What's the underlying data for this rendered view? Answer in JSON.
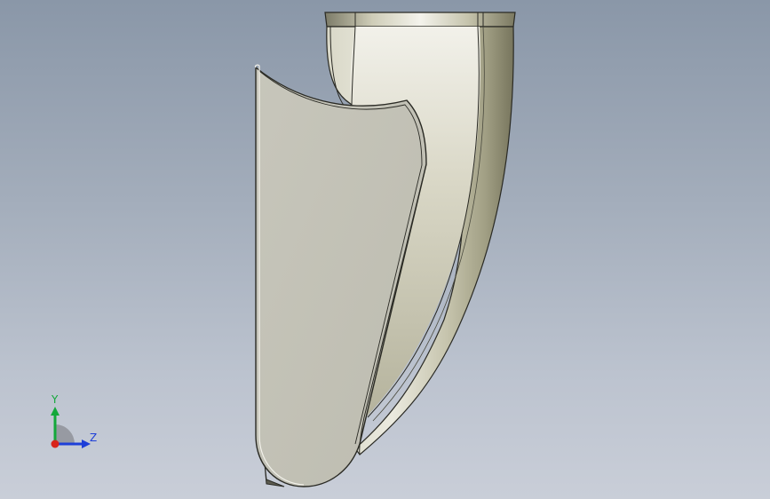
{
  "viewport": {
    "background_top": "#8a97a8",
    "background_bottom": "#c9ced8"
  },
  "model": {
    "face_color": "#c3c2b7",
    "edge_color": "#2a2a24"
  },
  "triad": {
    "y_label": "Y",
    "z_label": "Z",
    "y_color": "#13a83a",
    "z_color": "#1e3fd8",
    "x_color": "#d8231a"
  }
}
